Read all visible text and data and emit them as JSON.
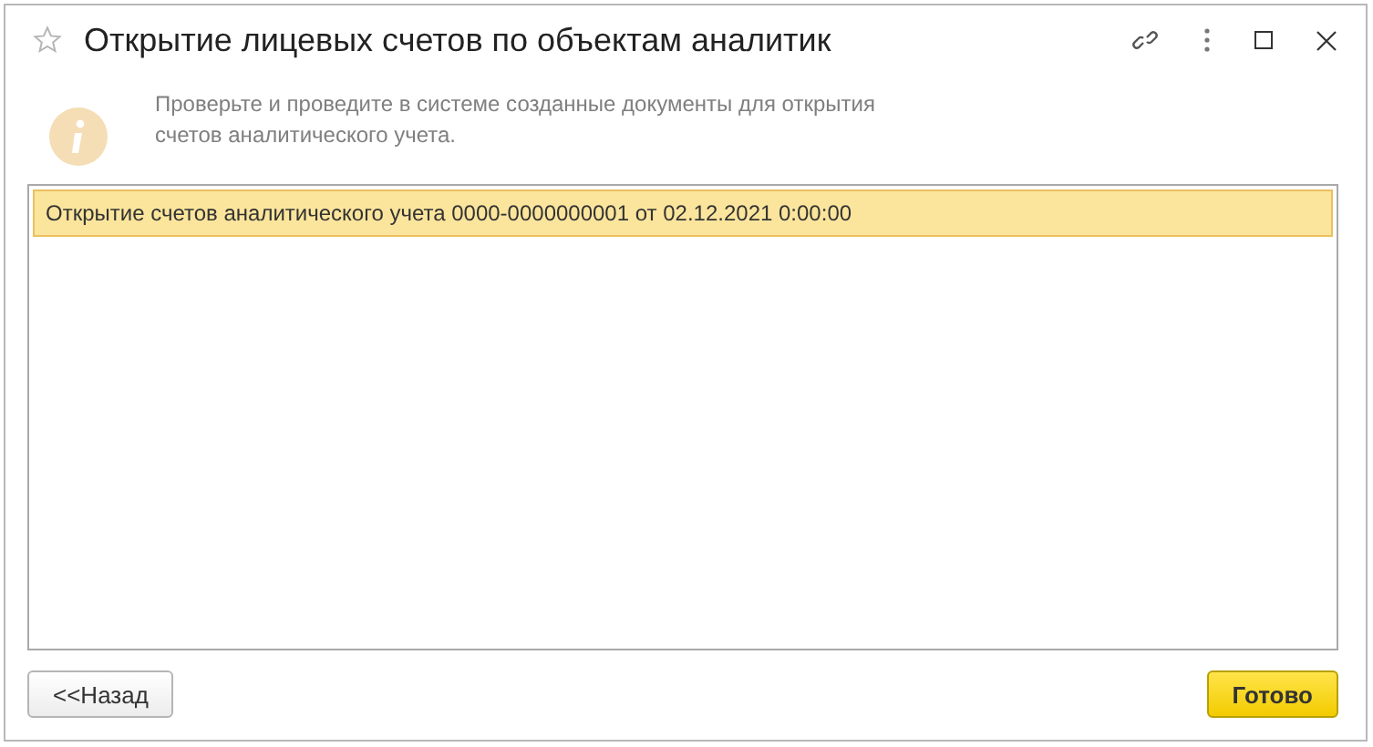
{
  "window": {
    "title": "Открытие лицевых счетов по объектам аналитик"
  },
  "info": {
    "text": "Проверьте и проведите в системе созданные документы для открытия  счетов аналитического учета."
  },
  "documents": [
    {
      "text": "Открытие счетов аналитического учета 0000-0000000001 от 02.12.2021 0:00:00",
      "selected": true
    }
  ],
  "buttons": [
    {
      "label": "<<Назад",
      "kind": "secondary"
    },
    {
      "label": "Готово",
      "kind": "primary"
    }
  ]
}
